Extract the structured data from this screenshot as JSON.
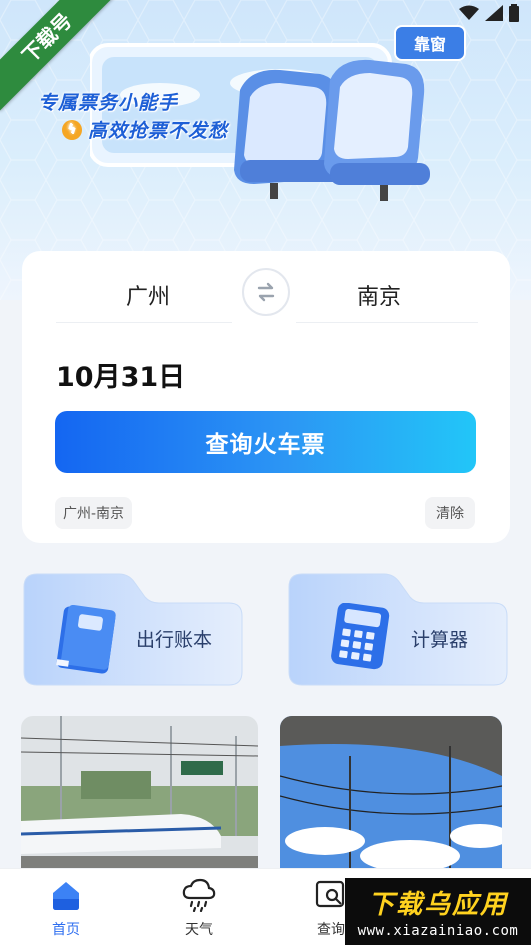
{
  "corner_ribbon": "下载号",
  "hero": {
    "headline": "专属票务小能手",
    "subline": "高效抢票不发愁",
    "window_badge": "靠窗"
  },
  "search": {
    "from_city": "广州",
    "to_city": "南京",
    "date": "10月31日",
    "query_button": "查询火车票",
    "history_item": "广州-南京",
    "clear_button": "清除"
  },
  "tools": [
    {
      "label": "出行账本",
      "icon": "notebook-icon"
    },
    {
      "label": "计算器",
      "icon": "calculator-icon"
    }
  ],
  "tabs": [
    {
      "label": "首页",
      "icon": "home-icon",
      "active": true
    },
    {
      "label": "天气",
      "icon": "weather-icon",
      "active": false
    },
    {
      "label": "查询",
      "icon": "search-doc-icon",
      "active": false
    }
  ],
  "watermark": {
    "title": "下载乌应用",
    "url": "www.xiazainiao.com"
  },
  "colors": {
    "accent": "#2f6ff0",
    "button_gradient_start": "#1466f2",
    "button_gradient_end": "#22c6f8",
    "ribbon": "#2e8b3e"
  }
}
